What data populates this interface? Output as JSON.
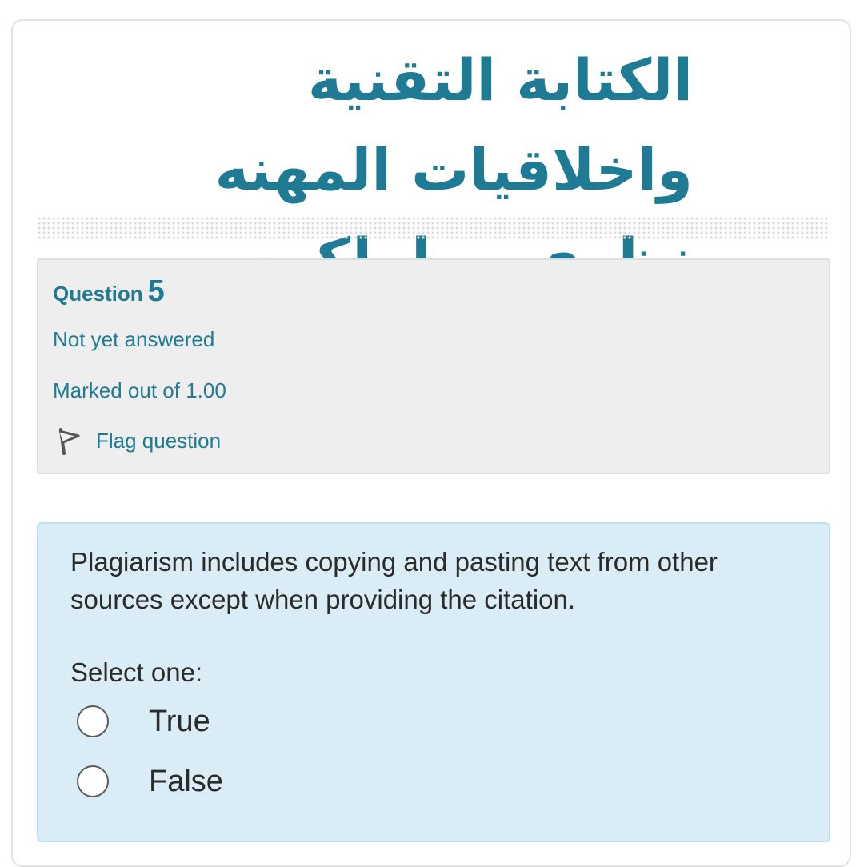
{
  "course": {
    "title": "الكتابة التقنية واخلاقيات المهنه نظرى - طولكرم"
  },
  "question_info": {
    "label": "Question",
    "number": "5",
    "state": "Not yet answered",
    "marks": "Marked out of 1.00",
    "flag_label": "Flag question",
    "flag_icon": "flag-icon"
  },
  "question": {
    "text": "Plagiarism includes copying and pasting text from other sources except when providing the citation.",
    "prompt": "Select one:",
    "options": [
      {
        "label": "True",
        "selected": false
      },
      {
        "label": "False",
        "selected": false
      }
    ]
  },
  "colors": {
    "accent": "#1f7a94",
    "info_bg": "#eeeeee",
    "question_bg": "#daedf6"
  }
}
